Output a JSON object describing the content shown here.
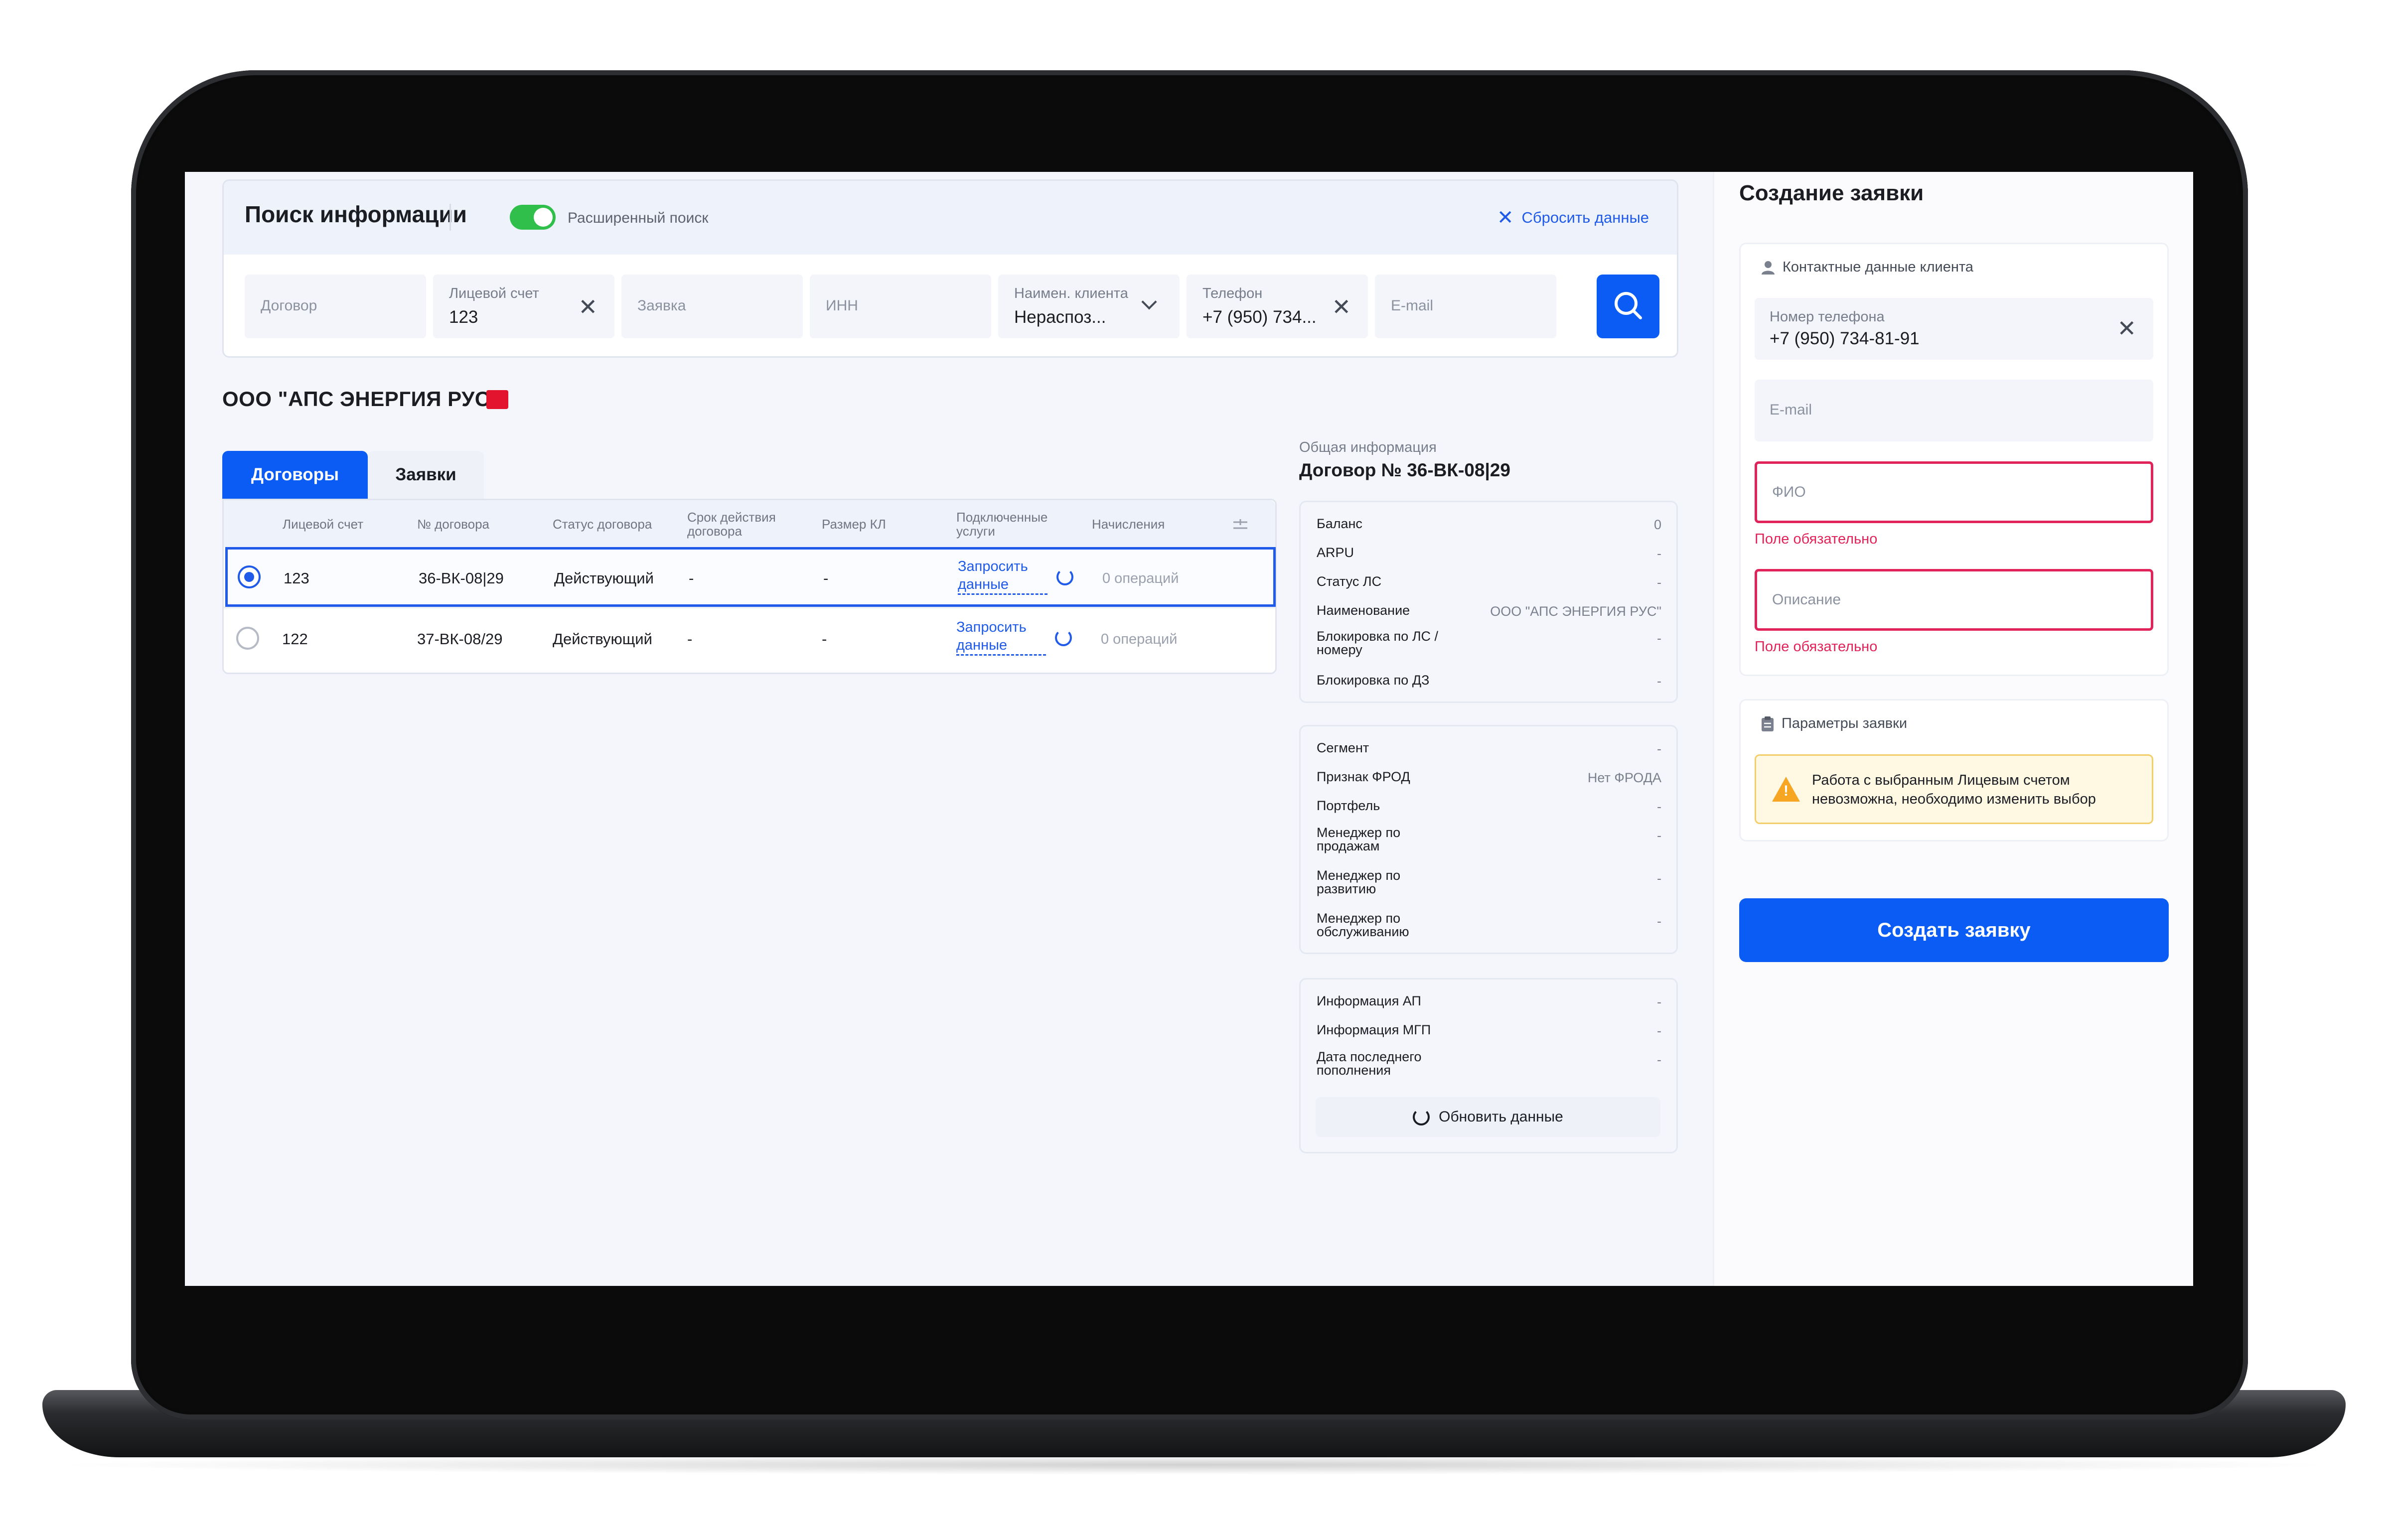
{
  "search": {
    "title": "Поиск информации",
    "advanced_label": "Расширенный поиск",
    "advanced_enabled": true,
    "reset_label": "Сбросить данные",
    "fields": {
      "contract": {
        "placeholder": "Договор"
      },
      "account": {
        "label": "Лицевой счет",
        "value": "123"
      },
      "request": {
        "placeholder": "Заявка"
      },
      "inn": {
        "placeholder": "ИНН"
      },
      "client": {
        "label": "Наимен. клиента",
        "value": "Нераспоз..."
      },
      "phone": {
        "label": "Телефон",
        "value": "+7 (950) 734..."
      },
      "email": {
        "placeholder": "E-mail"
      }
    }
  },
  "company": {
    "name": "ООО \"АПС ЭНЕРГИЯ РУС\""
  },
  "tabs": [
    {
      "label": "Договоры",
      "active": true
    },
    {
      "label": "Заявки",
      "active": false
    }
  ],
  "table": {
    "columns": {
      "account": "Лицевой счет",
      "contract_no": "№ договора",
      "status": "Статус договора",
      "term": "Срок действия договора",
      "kl": "Размер КЛ",
      "services": "Подключенные услуги",
      "charges": "Начисления"
    },
    "rows": [
      {
        "account": "123",
        "contract_no": "36-ВК-08|29",
        "status": "Действующий",
        "term": "-",
        "kl": "-",
        "services": "Запросить данные",
        "charges": "0 операций",
        "selected": true
      },
      {
        "account": "122",
        "contract_no": "37-ВК-08/29",
        "status": "Действующий",
        "term": "-",
        "kl": "-",
        "services": "Запросить данные",
        "charges": "0 операций",
        "selected": false
      }
    ]
  },
  "info": {
    "caption": "Общая информация",
    "title": "Договор № 36-ВК-08|29",
    "group1": [
      {
        "key": "Баланс",
        "value": "0"
      },
      {
        "key": "ARPU",
        "value": "-"
      },
      {
        "key": "Статус ЛС",
        "value": "-"
      },
      {
        "key": "Наименование",
        "value": "ООО \"АПС ЭНЕРГИЯ РУС\""
      },
      {
        "key": "Блокировка по ЛС / номеру",
        "value": "-"
      },
      {
        "key": "Блокировка по ДЗ",
        "value": "-"
      }
    ],
    "group2": [
      {
        "key": "Сегмент",
        "value": "-"
      },
      {
        "key": "Признак ФРОД",
        "value": "Нет ФРОДА"
      },
      {
        "key": "Портфель",
        "value": "-"
      },
      {
        "key": "Менеджер по продажам",
        "value": "-"
      },
      {
        "key": "Менеджер по развитию",
        "value": "-"
      },
      {
        "key": "Менеджер по обслуживанию",
        "value": "-"
      }
    ],
    "group3": [
      {
        "key": "Информация АП",
        "value": "-"
      },
      {
        "key": "Информация МГП",
        "value": "-"
      },
      {
        "key": "Дата последнего пополнения",
        "value": "-"
      }
    ],
    "update_label": "Обновить данные"
  },
  "sidebar": {
    "title": "Создание заявки",
    "contact": {
      "heading": "Контактные данные клиента",
      "phone_label": "Номер телефона",
      "phone_value": "+7 (950) 734-81-91",
      "email_placeholder": "E-mail",
      "fio_placeholder": "ФИО",
      "description_placeholder": "Описание",
      "required_error": "Поле обязательно"
    },
    "params": {
      "heading": "Параметры заявки",
      "warning": "Работа с выбранным Лицевым счетом невозможна, необходимо изменить выбор"
    },
    "create_label": "Создать заявку"
  },
  "colors": {
    "accent": "#0b5cf5",
    "error": "#e0245a",
    "toggle_on": "#2fbf4a",
    "warning_bg": "#fff9e4"
  }
}
